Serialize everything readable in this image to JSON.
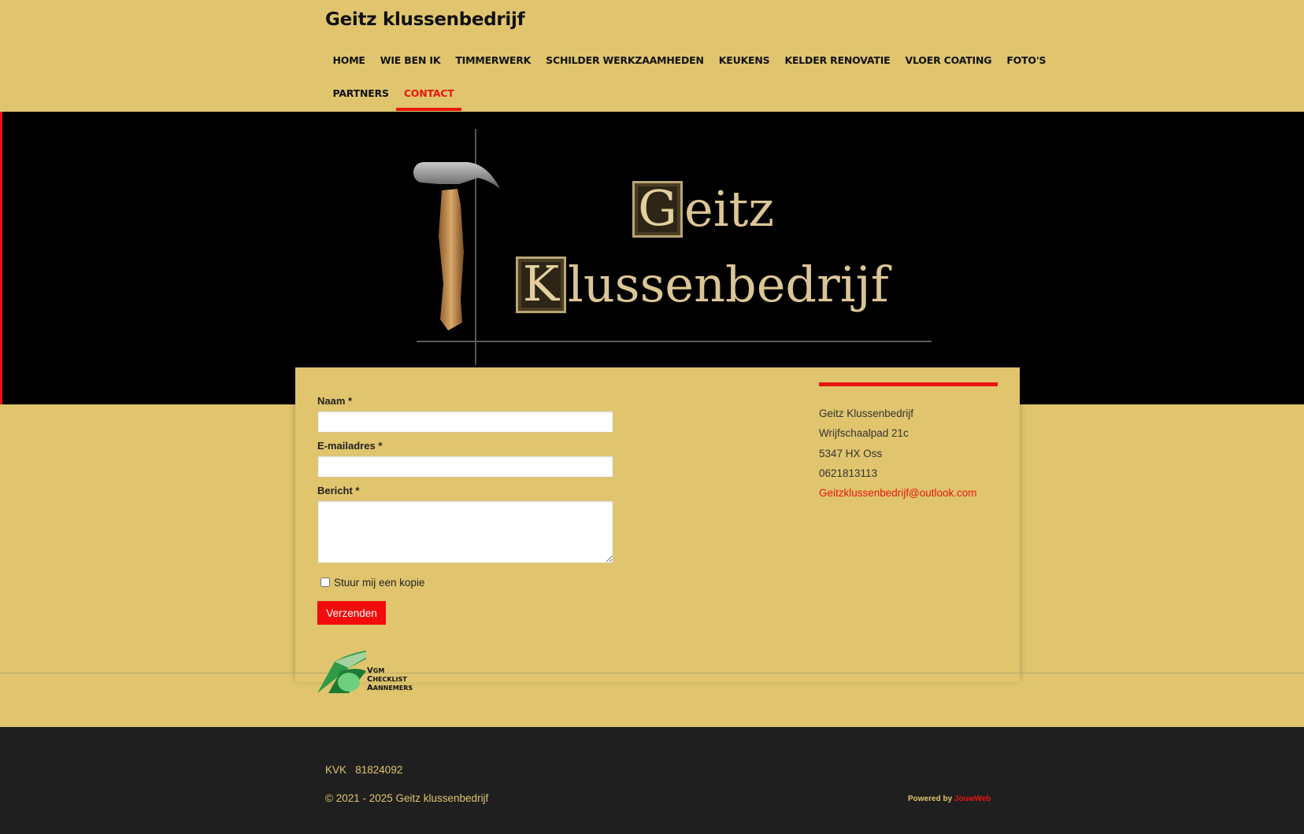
{
  "site": {
    "title": "Geitz klussenbedrijf"
  },
  "nav": {
    "row1": [
      "HOME",
      "WIE BEN IK",
      "TIMMERWERK",
      "SCHILDER WERKZAAMHEDEN",
      "KEUKENS",
      "KELDER RENOVATIE",
      "VLOER COATING",
      "FOTO'S"
    ],
    "row2": [
      "PARTNERS",
      "CONTACT"
    ],
    "active": "CONTACT"
  },
  "hero": {
    "logo_initial_1": "G",
    "logo_rest_1": "eitz",
    "logo_initial_2": "K",
    "logo_rest_2": "lussenbedrijf"
  },
  "form": {
    "name_label": "Naam *",
    "name_value": "",
    "email_label": "E-mailadres *",
    "email_value": "",
    "message_label": "Bericht *",
    "message_value": "",
    "copy_label": "Stuur mij een kopie",
    "copy_checked": false,
    "submit_label": "Verzenden"
  },
  "contact": {
    "company": "Geitz Klussenbedrijf",
    "street": "Wrijfschaalpad 21c",
    "city": "5347 HX Oss",
    "phone": "0621813113",
    "email": "Geitzklussenbedrijf@outlook.com"
  },
  "vca": {
    "lines": [
      [
        "V",
        "GM"
      ],
      [
        "C",
        "HECKLIST"
      ],
      [
        "A",
        "ANNEMERS"
      ]
    ]
  },
  "footer": {
    "kvk": "KVK   81824092",
    "copyright": "© 2021 - 2025 Geitz klussenbedrijf",
    "powered_prefix": "Powered by",
    "powered_brand": "JouwWeb"
  },
  "colors": {
    "background": "#e0c56e",
    "accent": "#e8160f",
    "footer": "#1f1f1f",
    "hero": "#000000"
  }
}
